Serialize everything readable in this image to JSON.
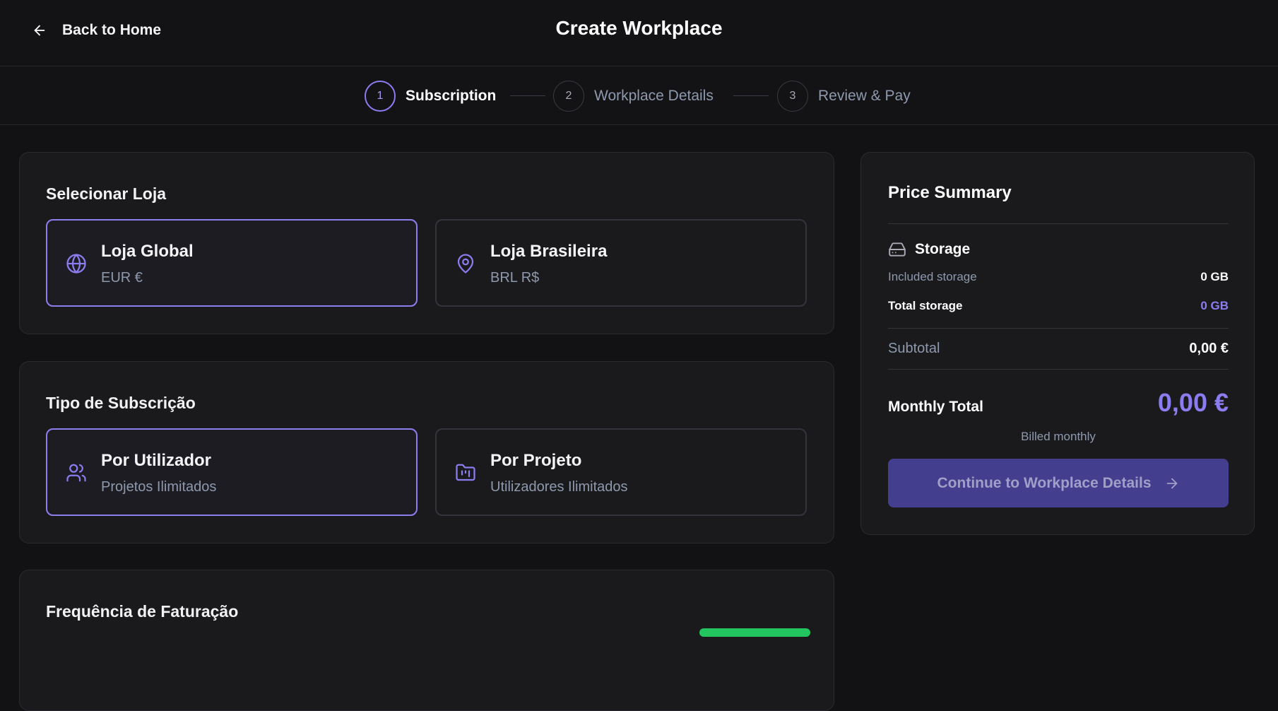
{
  "header": {
    "back_label": "Back to Home",
    "title": "Create Workplace",
    "back_icon": "arrow-left-icon"
  },
  "stepper": {
    "steps": [
      {
        "number": "1",
        "label": "Subscription",
        "active": true
      },
      {
        "number": "2",
        "label": "Workplace Details",
        "active": false
      },
      {
        "number": "3",
        "label": "Review & Pay",
        "active": false
      }
    ]
  },
  "store": {
    "title": "Selecionar Loja",
    "options": [
      {
        "title": "Loja Global",
        "subtitle": "EUR €",
        "icon": "globe-icon",
        "selected": true
      },
      {
        "title": "Loja Brasileira",
        "subtitle": "BRL R$",
        "icon": "map-pin-icon",
        "selected": false
      }
    ]
  },
  "subscription_type": {
    "title": "Tipo de Subscrição",
    "options": [
      {
        "title": "Por Utilizador",
        "subtitle": "Projetos Ilimitados",
        "icon": "users-icon",
        "selected": true
      },
      {
        "title": "Por Projeto",
        "subtitle": "Utilizadores Ilimitados",
        "icon": "folder-kanban-icon",
        "selected": false
      }
    ]
  },
  "billing_frequency": {
    "title": "Frequência de Faturação"
  },
  "summary": {
    "title": "Price Summary",
    "storage_heading": "Storage",
    "storage_icon": "hard-drive-icon",
    "included_storage_label": "Included storage",
    "included_storage_value": "0 GB",
    "total_storage_label": "Total storage",
    "total_storage_value": "0 GB",
    "subtotal_label": "Subtotal",
    "subtotal_value": "0,00 €",
    "monthly_total_label": "Monthly Total",
    "monthly_total_value": "0,00 €",
    "billed_note": "Billed monthly",
    "continue_label": "Continue to Workplace Details",
    "continue_icon": "arrow-right-icon"
  },
  "colors": {
    "accent": "#8b7cf0",
    "background": "#121214",
    "card": "#1a1a1d",
    "button": "#433f8e",
    "badge_green": "#22c55e"
  }
}
